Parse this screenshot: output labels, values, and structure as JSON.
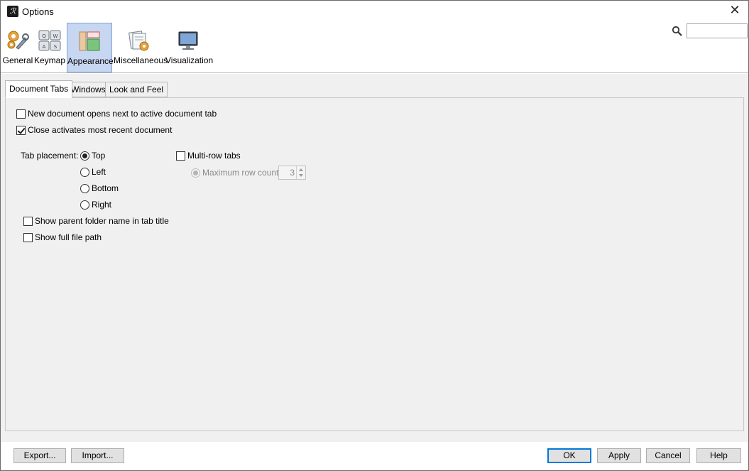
{
  "window": {
    "title": "Options",
    "app_icon_glyph": "ℛ"
  },
  "categories": [
    {
      "label": "General",
      "icon": "gears-wrench-icon",
      "selected": false
    },
    {
      "label": "Keymap",
      "icon": "keyboard-keys-icon",
      "selected": false
    },
    {
      "label": "Appearance",
      "icon": "layout-panels-icon",
      "selected": true
    },
    {
      "label": "Miscellaneous",
      "icon": "misc-stack-icon",
      "selected": false
    },
    {
      "label": "Visualization",
      "icon": "monitor-icon",
      "selected": false
    }
  ],
  "search": {
    "placeholder": "",
    "value": ""
  },
  "tabs": [
    {
      "label": "Document Tabs",
      "active": true
    },
    {
      "label": "Windows",
      "active": false
    },
    {
      "label": "Look and Feel",
      "active": false
    }
  ],
  "document_tabs": {
    "new_doc_next_to_active": {
      "label": "New document opens next to active document tab",
      "checked": false
    },
    "close_activates_recent": {
      "label": "Close activates most recent document",
      "checked": true
    },
    "tab_placement": {
      "label": "Tab placement:",
      "options": [
        {
          "label": "Top",
          "checked": true
        },
        {
          "label": "Left",
          "checked": false
        },
        {
          "label": "Bottom",
          "checked": false
        },
        {
          "label": "Right",
          "checked": false
        }
      ]
    },
    "multi_row_tabs": {
      "label": "Multi-row tabs",
      "checked": false
    },
    "max_row_count": {
      "label": "Maximum row count:",
      "value": "3",
      "enabled": false
    },
    "show_parent_folder": {
      "label": "Show parent folder name in tab title",
      "checked": false
    },
    "show_full_path": {
      "label": "Show full file path",
      "checked": false
    }
  },
  "buttons": {
    "export": "Export...",
    "import": "Import...",
    "ok": "OK",
    "apply": "Apply",
    "cancel": "Cancel",
    "help": "Help"
  }
}
